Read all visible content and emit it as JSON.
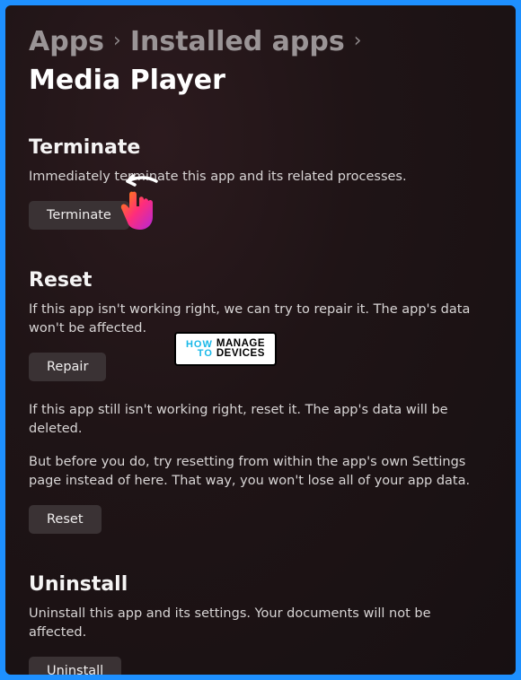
{
  "breadcrumb": {
    "items": [
      {
        "label": "Apps"
      },
      {
        "label": "Installed apps"
      },
      {
        "label": "Media Player"
      }
    ]
  },
  "sections": {
    "terminate": {
      "title": "Terminate",
      "desc": "Immediately terminate this app and its related processes.",
      "button": "Terminate"
    },
    "reset": {
      "title": "Reset",
      "desc1": "If this app isn't working right, we can try to repair it. The app's data won't be affected.",
      "repair_button": "Repair",
      "desc2": "If this app still isn't working right, reset it. The app's data will be deleted.",
      "desc3": "But before you do, try resetting from within the app's own Settings page instead of here. That way, you won't lose all of your app data.",
      "reset_button": "Reset"
    },
    "uninstall": {
      "title": "Uninstall",
      "desc": "Uninstall this app and its settings. Your documents will not be affected.",
      "button": "Uninstall"
    }
  },
  "watermark": {
    "left1": "HOW",
    "left2": "TO",
    "right1": "MANAGE",
    "right2": "DEVICES"
  }
}
